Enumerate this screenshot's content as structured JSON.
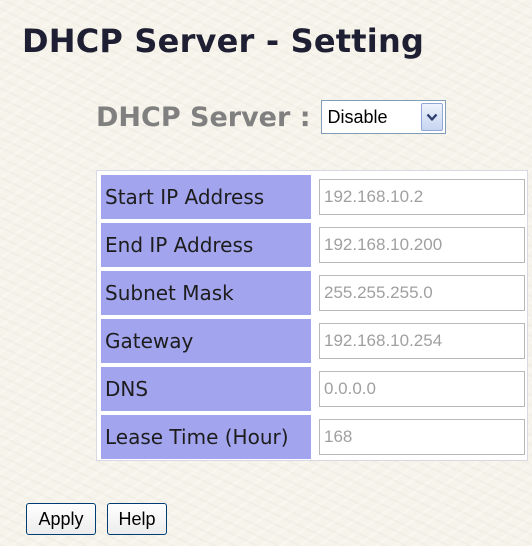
{
  "page_title": "DHCP Server - Setting",
  "dhcp_server": {
    "label": "DHCP Server :",
    "selected": "Disable",
    "icon": "chevron-down-icon"
  },
  "settings": [
    {
      "label": "Start IP Address",
      "value": "192.168.10.2"
    },
    {
      "label": "End IP Address",
      "value": "192.168.10.200"
    },
    {
      "label": "Subnet Mask",
      "value": "255.255.255.0"
    },
    {
      "label": "Gateway",
      "value": "192.168.10.254"
    },
    {
      "label": "DNS",
      "value": "0.0.0.0"
    },
    {
      "label": "Lease Time (Hour)",
      "value": "168"
    }
  ],
  "buttons": {
    "apply": "Apply",
    "help": "Help"
  },
  "colors": {
    "label_background": "#a2a4ee",
    "disabled_text": "#a0a0a0"
  }
}
